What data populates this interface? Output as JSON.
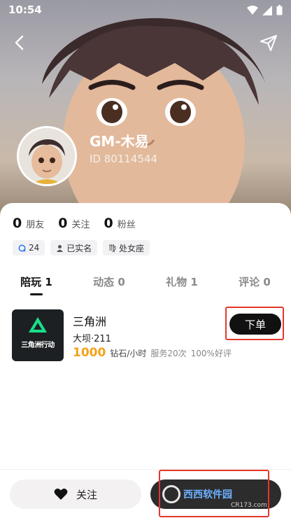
{
  "status_bar": {
    "time": "10:54"
  },
  "profile": {
    "nickname": "GM-木易",
    "user_id": "ID 80114544"
  },
  "stats": [
    {
      "value": "0",
      "label": "朋友"
    },
    {
      "value": "0",
      "label": "关注"
    },
    {
      "value": "0",
      "label": "粉丝"
    }
  ],
  "tags": [
    {
      "icon": "location-icon",
      "label": "24"
    },
    {
      "icon": "person-icon",
      "label": "已实名"
    },
    {
      "icon": "virgo-icon",
      "label": "处女座"
    }
  ],
  "tabs": [
    {
      "label": "陪玩 1",
      "active": true
    },
    {
      "label": "动态 0",
      "active": false
    },
    {
      "label": "礼物 1",
      "active": false
    },
    {
      "label": "评论 0",
      "active": false
    }
  ],
  "service": {
    "icon_text": "三角洲行动",
    "name": "三角洲",
    "sub": "大坝·211",
    "price": "1000",
    "unit": "钻石/小时",
    "served": "服务20次",
    "rating": "100%好评",
    "order_label": "下单"
  },
  "bottom": {
    "follow_label": "关注",
    "watermark_title": "西西软件园",
    "watermark_sub": "CR173.com"
  },
  "colors": {
    "price": "#f3a21b",
    "highlight": "#e4382a",
    "button_dark": "#111111"
  }
}
